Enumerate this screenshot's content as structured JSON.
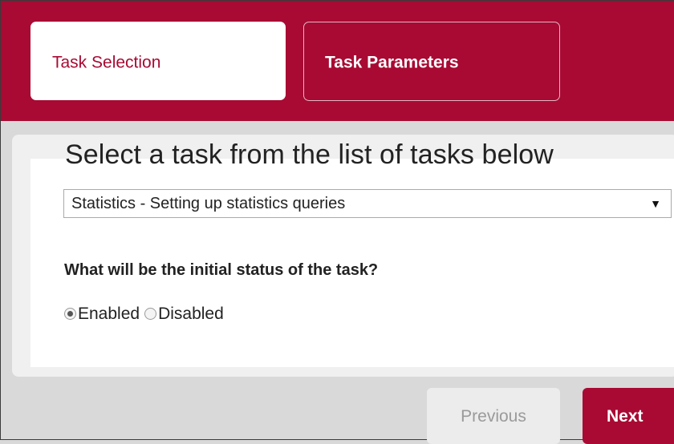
{
  "tabs": [
    {
      "label": "Task Selection"
    },
    {
      "label": "Task Parameters"
    }
  ],
  "main": {
    "title": "Select a task from the list of tasks below",
    "task_select": {
      "selected": "Statistics - Setting up statistics queries"
    },
    "status_question": "What will be the initial status of the task?",
    "status_options": [
      {
        "label": "Enabled",
        "checked": true
      },
      {
        "label": "Disabled",
        "checked": false
      }
    ]
  },
  "footer": {
    "previous_label": "Previous",
    "next_label": "Next"
  },
  "colors": {
    "brand": "#a80a33",
    "background": "#d9d9d9",
    "card": "#f0f0f0"
  }
}
